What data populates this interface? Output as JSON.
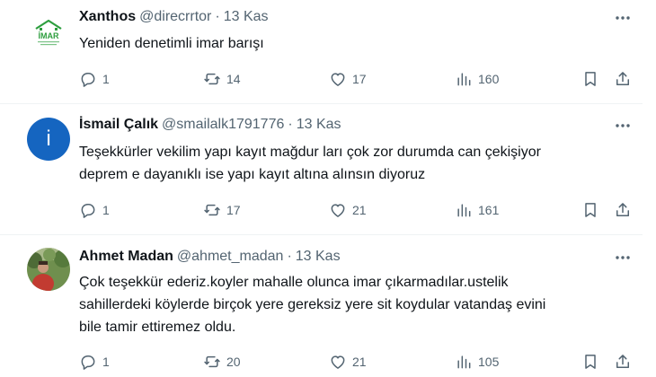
{
  "colors": {
    "text": "#0f1419",
    "muted": "#536471",
    "divider": "#eff3f4",
    "accent_blue": "#1565c0",
    "logo_green": "#2e9e3f"
  },
  "tweets": [
    {
      "name": "Xanthos",
      "handle": "@direcrrtor",
      "date": "13 Kas",
      "avatar": {
        "type": "logo",
        "text": "İMAR"
      },
      "lines": [
        "Yeniden denetimli imar barışı"
      ],
      "replies": "1",
      "retweets": "14",
      "likes": "17",
      "views": "160"
    },
    {
      "name": "İsmail Çalık",
      "handle": "@smailalk1791776",
      "date": "13 Kas",
      "avatar": {
        "type": "initial",
        "text": "i"
      },
      "lines": [
        "Teşekkürler vekilim yapı kayıt mağdur ları çok zor durumda can çekişiyor",
        "deprem e dayanıklı ise yapı kayıt altına alınsın diyoruz"
      ],
      "replies": "1",
      "retweets": "17",
      "likes": "21",
      "views": "161"
    },
    {
      "name": "Ahmet Madan",
      "handle": "@ahmet_madan",
      "date": "13 Kas",
      "avatar": {
        "type": "photo"
      },
      "lines": [
        "Çok teşekkür ederiz.koyler mahalle olunca imar çıkarmadılar.ustelik",
        "sahillerdeki köylerde birçok yere gereksiz yere sit koydular vatandaş evini",
        "bile tamir ettiremez oldu."
      ],
      "replies": "1",
      "retweets": "20",
      "likes": "21",
      "views": "105"
    }
  ]
}
